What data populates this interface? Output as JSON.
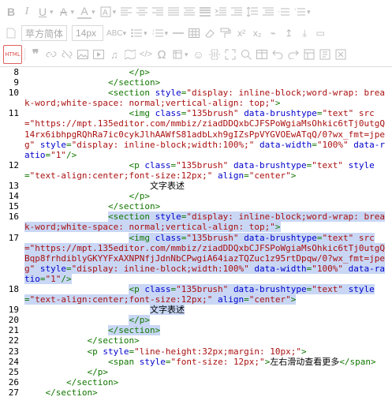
{
  "toolbar": {
    "row1": [
      "bold-icon",
      "italic-icon",
      "underline-icon",
      "strikethrough-icon",
      "font-color-icon",
      "background-color-icon",
      "align-left-icon",
      "align-center-icon",
      "align-right-icon",
      "align-justify-icon",
      "align-distribute-icon",
      "clear-format-icon",
      "indent-icon",
      "outdent-icon",
      "line-height-icon",
      "paragraph-spacing-icon",
      "hr-icon"
    ],
    "font_family": "苹方简体",
    "font_size": "14px",
    "case_label": "ABC",
    "row2_icons": [
      "letter-spacing-icon",
      "unordered-list-icon",
      "ordered-list-icon",
      "horizontal-rule-icon",
      "table-icon",
      "eraser-icon",
      "format-painter-icon",
      "superscript-icon",
      "subscript-icon"
    ],
    "html_label": "HTML",
    "row3_icons": [
      "quote-icon",
      "link-icon",
      "unlink-icon",
      "image-icon",
      "video-icon",
      "music-icon",
      "map-icon",
      "code-icon",
      "omega-icon",
      "symbol-icon",
      "emoji-icon",
      "pagebreak-icon",
      "fullscreen-icon",
      "search-icon",
      "table-edit-icon",
      "undo-icon",
      "redo-icon",
      "template-icon",
      "preview-icon",
      "clear-icon"
    ]
  },
  "editor": {
    "lines": [
      {
        "n": "8",
        "indent": "                    ",
        "parts": [
          [
            "tag",
            "</p>"
          ]
        ],
        "hl": false
      },
      {
        "n": "9",
        "indent": "                ",
        "parts": [
          [
            "tag",
            "</section>"
          ]
        ],
        "hl": false
      },
      {
        "n": "10",
        "indent": "                ",
        "parts": [
          [
            "tag",
            "<section "
          ],
          [
            "attr",
            "style"
          ],
          [
            "tag",
            "="
          ],
          [
            "str",
            "\"display: inline-block;word-wrap: break-word;white-space: normal;vertical-align: top;\""
          ],
          [
            "tag",
            ">"
          ]
        ],
        "hl": false
      },
      {
        "n": "11",
        "indent": "                    ",
        "parts": [
          [
            "tag",
            "<img "
          ],
          [
            "attr",
            "class"
          ],
          [
            "tag",
            "="
          ],
          [
            "str",
            "\"135brush\""
          ],
          [
            "tag",
            " "
          ],
          [
            "attr",
            "data-brushtype"
          ],
          [
            "tag",
            "="
          ],
          [
            "str",
            "\"text\" src=\"https://mpt.135editor.com/mmbiz/ziadDDQxbCJFSPoWgiaMsOhkic6tTj0utgQ14rx6ibhpgRQhRa7ic0cykJlhAAWfS81adbLxh9gIZsPpVYGVOEwATqQ/0?wx_fmt=jpeg\""
          ],
          [
            "tag",
            " "
          ],
          [
            "attr",
            "style"
          ],
          [
            "tag",
            "="
          ],
          [
            "str",
            "\"display: inline-block;width:100%;\""
          ],
          [
            "tag",
            " "
          ],
          [
            "attr",
            "data-width"
          ],
          [
            "tag",
            "="
          ],
          [
            "str",
            "\"100%\""
          ],
          [
            "tag",
            " "
          ],
          [
            "attr",
            "data-ratio"
          ],
          [
            "tag",
            "="
          ],
          [
            "str",
            "\"1\""
          ],
          [
            "tag",
            "/>"
          ]
        ],
        "hl": false
      },
      {
        "n": "12",
        "indent": "                    ",
        "parts": [
          [
            "tag",
            "<p "
          ],
          [
            "attr",
            "class"
          ],
          [
            "tag",
            "="
          ],
          [
            "str",
            "\"135brush\""
          ],
          [
            "tag",
            " "
          ],
          [
            "attr",
            "data-brushtype"
          ],
          [
            "tag",
            "="
          ],
          [
            "str",
            "\"text\""
          ],
          [
            "tag",
            " "
          ],
          [
            "attr",
            "style"
          ],
          [
            "tag",
            "="
          ],
          [
            "str",
            "\"text-align:center;font-size:12px;\""
          ],
          [
            "tag",
            " "
          ],
          [
            "attr",
            "align"
          ],
          [
            "tag",
            "="
          ],
          [
            "str",
            "\"center\""
          ],
          [
            "tag",
            ">"
          ]
        ],
        "hl": false
      },
      {
        "n": "13",
        "indent": "                        ",
        "parts": [
          [
            "txt",
            "文字表述"
          ]
        ],
        "hl": false
      },
      {
        "n": "14",
        "indent": "                    ",
        "parts": [
          [
            "tag",
            "</p>"
          ]
        ],
        "hl": false
      },
      {
        "n": "15",
        "indent": "                ",
        "parts": [
          [
            "tag",
            "</section>"
          ]
        ],
        "hl": false
      },
      {
        "n": "16",
        "indent": "                ",
        "parts": [
          [
            "tag",
            "<section "
          ],
          [
            "attr",
            "style"
          ],
          [
            "tag",
            "="
          ],
          [
            "str",
            "\"display: inline-block;word-wrap: break-word;white-space: normal;vertical-align: top;\""
          ],
          [
            "tag",
            ">"
          ]
        ],
        "hl": true
      },
      {
        "n": "17",
        "indent": "                    ",
        "parts": [
          [
            "tag",
            "<img "
          ],
          [
            "attr",
            "class"
          ],
          [
            "tag",
            "="
          ],
          [
            "str",
            "\"135brush\""
          ],
          [
            "tag",
            " "
          ],
          [
            "attr",
            "data-brushtype"
          ],
          [
            "tag",
            "="
          ],
          [
            "str",
            "\"text\" src=\"https://mpt.135editor.com/mmbiz/ziadDDQxbCJFSPoWgiaMsOhkic6tTj0utgQBqp8frhdiblyGKYYFxAXNPNfjJdnNbCPwgiA64iazTQZuc1z95rtDpqw/0?wx_fmt=jpeg\""
          ],
          [
            "tag",
            " "
          ],
          [
            "attr",
            "style"
          ],
          [
            "tag",
            "="
          ],
          [
            "str",
            "\"display: inline-block;width:100%\""
          ],
          [
            "tag",
            " "
          ],
          [
            "attr",
            "data-width"
          ],
          [
            "tag",
            "="
          ],
          [
            "str",
            "\"100%\""
          ],
          [
            "tag",
            " "
          ],
          [
            "attr",
            "data-ratio"
          ],
          [
            "tag",
            "="
          ],
          [
            "str",
            "\"1\""
          ],
          [
            "tag",
            "/>"
          ]
        ],
        "hl": true
      },
      {
        "n": "18",
        "indent": "                    ",
        "parts": [
          [
            "tag",
            "<p "
          ],
          [
            "attr",
            "class"
          ],
          [
            "tag",
            "="
          ],
          [
            "str",
            "\"135brush\""
          ],
          [
            "tag",
            " "
          ],
          [
            "attr",
            "data-brushtype"
          ],
          [
            "tag",
            "="
          ],
          [
            "str",
            "\"text\""
          ],
          [
            "tag",
            " "
          ],
          [
            "attr",
            "style"
          ],
          [
            "tag",
            "="
          ],
          [
            "str",
            "\"text-align:center;font-size:12px;\""
          ],
          [
            "tag",
            " "
          ],
          [
            "attr",
            "align"
          ],
          [
            "tag",
            "="
          ],
          [
            "str",
            "\"center\""
          ],
          [
            "tag",
            ">"
          ]
        ],
        "hl": true
      },
      {
        "n": "19",
        "indent": "                        ",
        "parts": [
          [
            "txt",
            "文字表述"
          ]
        ],
        "hl": true
      },
      {
        "n": "20",
        "indent": "                    ",
        "parts": [
          [
            "tag",
            "</p>"
          ]
        ],
        "hl": true
      },
      {
        "n": "21",
        "indent": "                ",
        "parts": [
          [
            "tag",
            "</section>"
          ]
        ],
        "hl": true
      },
      {
        "n": "22",
        "indent": "            ",
        "parts": [
          [
            "tag",
            "</section>"
          ]
        ],
        "hl": false
      },
      {
        "n": "23",
        "indent": "            ",
        "parts": [
          [
            "tag",
            "<p "
          ],
          [
            "attr",
            "style"
          ],
          [
            "tag",
            "="
          ],
          [
            "str",
            "\"line-height:32px;margin: 10px;\""
          ],
          [
            "tag",
            ">"
          ]
        ],
        "hl": false
      },
      {
        "n": "24",
        "indent": "                ",
        "parts": [
          [
            "tag",
            "<span "
          ],
          [
            "attr",
            "style"
          ],
          [
            "tag",
            "="
          ],
          [
            "str",
            "\"font-size: 12px;\""
          ],
          [
            "tag",
            ">"
          ],
          [
            "txt",
            "左右滑动查看更多"
          ],
          [
            "tag",
            "</span>"
          ]
        ],
        "hl": false
      },
      {
        "n": "25",
        "indent": "            ",
        "parts": [
          [
            "tag",
            "</p>"
          ]
        ],
        "hl": false
      },
      {
        "n": "26",
        "indent": "        ",
        "parts": [
          [
            "tag",
            "</section>"
          ]
        ],
        "hl": false
      },
      {
        "n": "27",
        "indent": "    ",
        "parts": [
          [
            "tag",
            "</section>"
          ]
        ],
        "hl": false
      }
    ]
  }
}
